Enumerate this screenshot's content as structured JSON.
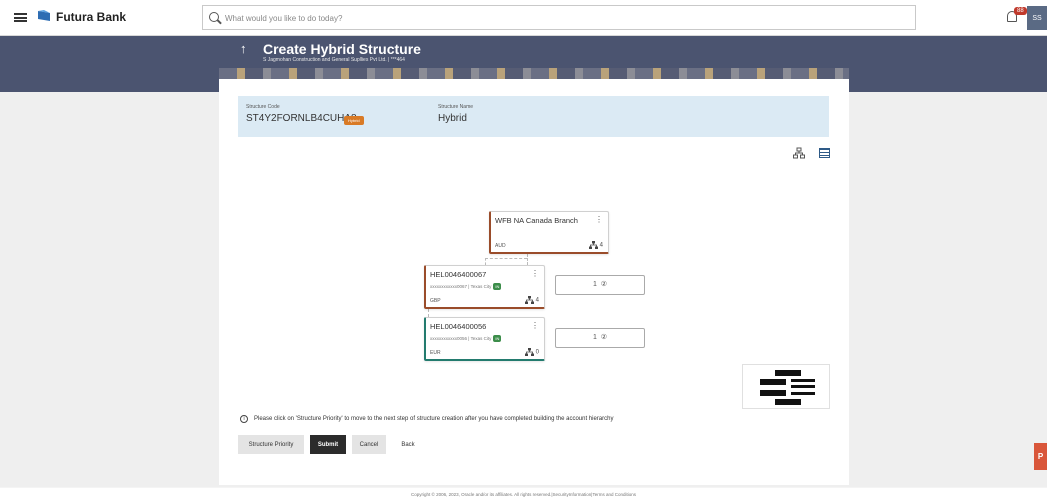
{
  "app": {
    "brand": "Futura Bank",
    "notification_count": "88",
    "avatar_initials": "SS"
  },
  "search": {
    "placeholder": "What would you like to do today?"
  },
  "header": {
    "back_glyph": "↑",
    "title": "Create Hybrid Structure",
    "subtitle": "S Jagmohan Construction and General Supllies Pvt Ltd. | ***464"
  },
  "structure": {
    "code_label": "Structure Code",
    "code_value": "ST4Y2FORNLB4CUHA8",
    "tag": "Hybrid",
    "name_label": "Structure Name",
    "name_value": "Hybrid"
  },
  "nodes": [
    {
      "title": "WFB NA Canada Branch",
      "subtitle": "",
      "currency": "AUD",
      "count": "4",
      "tag": ""
    },
    {
      "title": "HEL0046400067",
      "subtitle": "xxxxxxxxxxxx0067 | Texas City",
      "currency": "GBP",
      "count": "4",
      "tag": "IN"
    },
    {
      "title": "HEL0046400056",
      "subtitle": "xxxxxxxxxxxx0056 | Texas City",
      "currency": "EUR",
      "count": "0",
      "tag": "IN"
    }
  ],
  "priority_boxes": [
    {
      "value": "1",
      "help": "②"
    },
    {
      "value": "1",
      "help": "②"
    }
  ],
  "info_message": "Please click on 'Structure Priority' to move to the next step of structure creation after you have completed building the account hierarchy",
  "buttons": {
    "priority": "Structure Priority",
    "submit": "Submit",
    "cancel": "Cancel",
    "back": "Back"
  },
  "footer": "Copyright © 2006, 2023, Oracle and/or its affiliates. All rights reserved.|SecurityInformation|Terms and Conditions",
  "float_button": "P",
  "colors": {
    "banner": "#4b5470",
    "hybrid_tag": "#d97a25",
    "node_border_brown": "#9a4c2a",
    "node_border_teal": "#237b6e",
    "submit_bg": "#2b2b2b"
  }
}
